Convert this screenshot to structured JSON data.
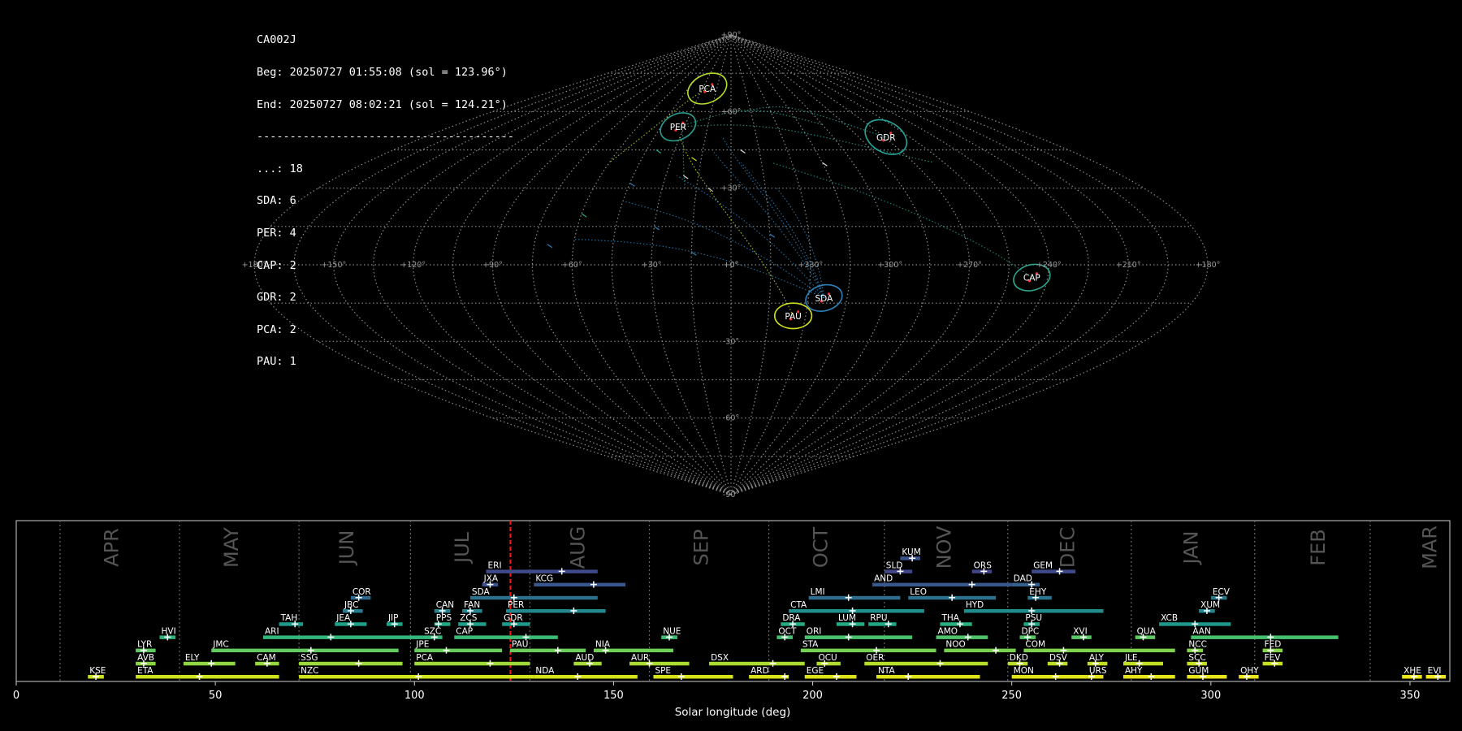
{
  "info": {
    "lines": [
      "CA002J",
      "Beg: 20250727 01:55:08 (sol = 123.96°)",
      "End: 20250727 08:02:21 (sol = 124.21°)",
      "---------------------------------------",
      "...: 18",
      "SDA: 6",
      "PER: 4",
      "CAP: 2",
      "GDR: 2",
      "PCA: 2",
      "PAU: 1"
    ]
  },
  "sky_map": {
    "projection": "sinusoidal",
    "center_lon": 0,
    "lon_labels": [
      "+180°",
      "+150°",
      "+120°",
      "+90°",
      "+60°",
      "+30°",
      "+0°",
      "+330°",
      "+300°",
      "+270°",
      "+240°",
      "+210°",
      "+180°"
    ],
    "lat_labels": [
      "+90°",
      "+60°",
      "+30°",
      "+0°",
      "-30°",
      "-60°",
      "-90°"
    ],
    "radiants": [
      {
        "code": "PCA",
        "lon": 25,
        "lat": 69,
        "r": 5.5,
        "color": "#b5de2b"
      },
      {
        "code": "PER",
        "lon": 34,
        "lat": 54,
        "r": 5,
        "color": "#2a9d8f"
      },
      {
        "code": "GDR",
        "lon": -91,
        "lat": 50,
        "r": 6,
        "color": "#26a69a"
      },
      {
        "code": "CAP",
        "lon": -114,
        "lat": -5,
        "r": 5,
        "color": "#2ea58f"
      },
      {
        "code": "SDA",
        "lon": -36,
        "lat": -13,
        "r": 5,
        "color": "#2c7fb8"
      },
      {
        "code": "PAU",
        "lon": -25,
        "lat": -20,
        "r": 5,
        "color": "#d0e11c"
      }
    ]
  },
  "chart_data": {
    "type": "timeline",
    "xlabel": "Solar longitude (deg)",
    "xlim": [
      0,
      360
    ],
    "x_ticks": [
      0,
      50,
      100,
      150,
      200,
      250,
      300,
      350
    ],
    "current_sol": 124.1,
    "months": [
      {
        "name": "APR",
        "start": 11,
        "center": 24
      },
      {
        "name": "MAY",
        "start": 41,
        "center": 54
      },
      {
        "name": "JUN",
        "start": 71,
        "center": 83
      },
      {
        "name": "JUL",
        "start": 99,
        "center": 112
      },
      {
        "name": "AUG",
        "start": 129,
        "center": 141
      },
      {
        "name": "SEP",
        "start": 159,
        "center": 172
      },
      {
        "name": "OCT",
        "start": 189,
        "center": 202
      },
      {
        "name": "NOV",
        "start": 218,
        "center": 233
      },
      {
        "name": "DEC",
        "start": 249,
        "center": 264
      },
      {
        "name": "JAN",
        "start": 280,
        "center": 295
      },
      {
        "name": "FEB",
        "start": 311,
        "center": 327
      },
      {
        "name": "MAR",
        "start": 340,
        "center": 355
      }
    ],
    "showers": [
      {
        "code": "KUM",
        "row": 9,
        "start": 222,
        "end": 227,
        "peak": 225,
        "color": "#3b528b"
      },
      {
        "code": "ERI",
        "row": 8,
        "start": 118,
        "end": 146,
        "peak": 137,
        "color": "#3e4a89"
      },
      {
        "code": "SLD",
        "row": 8,
        "start": 218,
        "end": 225,
        "peak": 222,
        "color": "#404688"
      },
      {
        "code": "ORS",
        "row": 8,
        "start": 240,
        "end": 245,
        "peak": 243,
        "color": "#414487"
      },
      {
        "code": "GEM",
        "row": 8,
        "start": 255,
        "end": 266,
        "peak": 262,
        "color": "#3e4a89"
      },
      {
        "code": "JXA",
        "row": 7,
        "start": 117,
        "end": 121,
        "peak": 119,
        "color": "#3b528b"
      },
      {
        "code": "KCG",
        "row": 7,
        "start": 130,
        "end": 153,
        "peak": 145,
        "color": "#39568c"
      },
      {
        "code": "AND",
        "row": 7,
        "start": 215,
        "end": 250,
        "peak": 240,
        "color": "#38588c"
      },
      {
        "code": "DAD",
        "row": 7,
        "start": 250,
        "end": 257,
        "peak": 255,
        "color": "#355f8d"
      },
      {
        "code": "COR",
        "row": 6,
        "start": 84,
        "end": 89,
        "peak": 86,
        "color": "#31688e"
      },
      {
        "code": "SDA",
        "row": 6,
        "start": 114,
        "end": 146,
        "peak": 125,
        "color": "#2d708e"
      },
      {
        "code": "LMI",
        "row": 6,
        "start": 199,
        "end": 222,
        "peak": 209,
        "color": "#2f6c8e"
      },
      {
        "code": "LEO",
        "row": 6,
        "start": 224,
        "end": 246,
        "peak": 235,
        "color": "#2c718e"
      },
      {
        "code": "EHY",
        "row": 6,
        "start": 254,
        "end": 260,
        "peak": 256,
        "color": "#2a768e"
      },
      {
        "code": "ECV",
        "row": 6,
        "start": 300,
        "end": 304,
        "peak": 302,
        "color": "#2a788e"
      },
      {
        "code": "JBC",
        "row": 5,
        "start": 82,
        "end": 87,
        "peak": 84,
        "color": "#287c8e"
      },
      {
        "code": "CAN",
        "row": 5,
        "start": 105,
        "end": 109,
        "peak": 107,
        "color": "#26828e"
      },
      {
        "code": "FAN",
        "row": 5,
        "start": 112,
        "end": 117,
        "peak": 114,
        "color": "#25838e"
      },
      {
        "code": "PER",
        "row": 5,
        "start": 123,
        "end": 148,
        "peak": 140,
        "color": "#23888e"
      },
      {
        "code": "CTA",
        "row": 5,
        "start": 194,
        "end": 228,
        "peak": 210,
        "color": "#21908d"
      },
      {
        "code": "HYD",
        "row": 5,
        "start": 238,
        "end": 273,
        "peak": 255,
        "color": "#228c8d"
      },
      {
        "code": "XUM",
        "row": 5,
        "start": 297,
        "end": 301,
        "peak": 299,
        "color": "#24868e"
      },
      {
        "code": "TAH",
        "row": 4,
        "start": 66,
        "end": 72,
        "peak": 70,
        "color": "#1f9a8a"
      },
      {
        "code": "JEA",
        "row": 4,
        "start": 80,
        "end": 88,
        "peak": 84,
        "color": "#1fa088"
      },
      {
        "code": "JIP",
        "row": 4,
        "start": 93,
        "end": 97,
        "peak": 95,
        "color": "#20a386"
      },
      {
        "code": "PPS",
        "row": 4,
        "start": 105,
        "end": 109,
        "peak": 106,
        "color": "#22a884"
      },
      {
        "code": "ZCS",
        "row": 4,
        "start": 111,
        "end": 118,
        "peak": 114,
        "color": "#1f9e89"
      },
      {
        "code": "GDR",
        "row": 4,
        "start": 122,
        "end": 129,
        "peak": 125,
        "color": "#1e9b8a"
      },
      {
        "code": "DRA",
        "row": 4,
        "start": 192,
        "end": 198,
        "peak": 195,
        "color": "#25ab82"
      },
      {
        "code": "LUM",
        "row": 4,
        "start": 206,
        "end": 213,
        "peak": 210,
        "color": "#23a983"
      },
      {
        "code": "RPU",
        "row": 4,
        "start": 214,
        "end": 221,
        "peak": 219,
        "color": "#22a785"
      },
      {
        "code": "THA",
        "row": 4,
        "start": 232,
        "end": 240,
        "peak": 237,
        "color": "#2ab07f"
      },
      {
        "code": "PSU",
        "row": 4,
        "start": 253,
        "end": 257,
        "peak": 255,
        "color": "#21a685"
      },
      {
        "code": "XCB",
        "row": 4,
        "start": 287,
        "end": 305,
        "peak": 296,
        "color": "#1f988b"
      },
      {
        "code": "HVI",
        "row": 3,
        "start": 36,
        "end": 40,
        "peak": 38,
        "color": "#2fb47c"
      },
      {
        "code": "ARI",
        "row": 3,
        "start": 62,
        "end": 102,
        "peak": 79,
        "color": "#33b67a"
      },
      {
        "code": "SZC",
        "row": 3,
        "start": 102,
        "end": 107,
        "peak": 105,
        "color": "#35b779"
      },
      {
        "code": "CAP",
        "row": 3,
        "start": 110,
        "end": 136,
        "peak": 128,
        "color": "#3bbb75"
      },
      {
        "code": "NUE",
        "row": 3,
        "start": 162,
        "end": 166,
        "peak": 164,
        "color": "#3fbc73"
      },
      {
        "code": "OCT",
        "row": 3,
        "start": 191,
        "end": 195,
        "peak": 193,
        "color": "#44bf70"
      },
      {
        "code": "ORI",
        "row": 3,
        "start": 198,
        "end": 225,
        "peak": 209,
        "color": "#4ac16d"
      },
      {
        "code": "AMO",
        "row": 3,
        "start": 231,
        "end": 244,
        "peak": 239,
        "color": "#50c46a"
      },
      {
        "code": "DPC",
        "row": 3,
        "start": 252,
        "end": 256,
        "peak": 254,
        "color": "#55c667"
      },
      {
        "code": "XVI",
        "row": 3,
        "start": 265,
        "end": 270,
        "peak": 268,
        "color": "#5ac864"
      },
      {
        "code": "QUA",
        "row": 3,
        "start": 281,
        "end": 286,
        "peak": 283,
        "color": "#5ec962"
      },
      {
        "code": "AAN",
        "row": 3,
        "start": 295,
        "end": 332,
        "peak": 315,
        "color": "#48c16e"
      },
      {
        "code": "LYR",
        "row": 2,
        "start": 30,
        "end": 35,
        "peak": 32,
        "color": "#5ec962"
      },
      {
        "code": "JMC",
        "row": 2,
        "start": 49,
        "end": 96,
        "peak": 74,
        "color": "#63cb5f"
      },
      {
        "code": "JPE",
        "row": 2,
        "start": 100,
        "end": 122,
        "peak": 108,
        "color": "#67cc5c"
      },
      {
        "code": "PAU",
        "row": 2,
        "start": 124,
        "end": 143,
        "peak": 136,
        "color": "#6ccd5a"
      },
      {
        "code": "NIA",
        "row": 2,
        "start": 145,
        "end": 165,
        "peak": 148,
        "color": "#70cf57"
      },
      {
        "code": "STA",
        "row": 2,
        "start": 197,
        "end": 231,
        "peak": 216,
        "color": "#75d054"
      },
      {
        "code": "NOO",
        "row": 2,
        "start": 233,
        "end": 251,
        "peak": 246,
        "color": "#7ad151"
      },
      {
        "code": "COM",
        "row": 2,
        "start": 253,
        "end": 291,
        "peak": 263,
        "color": "#7fd34e"
      },
      {
        "code": "NCC",
        "row": 2,
        "start": 294,
        "end": 298,
        "peak": 296,
        "color": "#84d44b"
      },
      {
        "code": "FED",
        "row": 2,
        "start": 313,
        "end": 318,
        "peak": 315,
        "color": "#86d549"
      },
      {
        "code": "AVB",
        "row": 1,
        "start": 30,
        "end": 35,
        "peak": 32,
        "color": "#8bd646"
      },
      {
        "code": "ELY",
        "row": 1,
        "start": 42,
        "end": 55,
        "peak": 49,
        "color": "#90d743"
      },
      {
        "code": "CAM",
        "row": 1,
        "start": 60,
        "end": 66,
        "peak": 63,
        "color": "#95d840"
      },
      {
        "code": "SSG",
        "row": 1,
        "start": 71,
        "end": 97,
        "peak": 86,
        "color": "#9bd93c"
      },
      {
        "code": "PCA",
        "row": 1,
        "start": 100,
        "end": 129,
        "peak": 119,
        "color": "#a0da39"
      },
      {
        "code": "AUD",
        "row": 1,
        "start": 140,
        "end": 147,
        "peak": 144,
        "color": "#a5db36"
      },
      {
        "code": "AUR",
        "row": 1,
        "start": 154,
        "end": 169,
        "peak": 159,
        "color": "#aadc32"
      },
      {
        "code": "DSX",
        "row": 1,
        "start": 174,
        "end": 198,
        "peak": 190,
        "color": "#addc30"
      },
      {
        "code": "OCU",
        "row": 1,
        "start": 201,
        "end": 207,
        "peak": 203,
        "color": "#b0dd2f"
      },
      {
        "code": "OER",
        "row": 1,
        "start": 213,
        "end": 244,
        "peak": 232,
        "color": "#b5de2b"
      },
      {
        "code": "DKD",
        "row": 1,
        "start": 249,
        "end": 254,
        "peak": 252,
        "color": "#b8de29"
      },
      {
        "code": "DSV",
        "row": 1,
        "start": 259,
        "end": 264,
        "peak": 262,
        "color": "#bade28"
      },
      {
        "code": "ALY",
        "row": 1,
        "start": 269,
        "end": 274,
        "peak": 271,
        "color": "#bfdf25"
      },
      {
        "code": "JLE",
        "row": 1,
        "start": 278,
        "end": 288,
        "peak": 282,
        "color": "#c2df23"
      },
      {
        "code": "SCC",
        "row": 1,
        "start": 294,
        "end": 299,
        "peak": 297,
        "color": "#c5e021"
      },
      {
        "code": "FEV",
        "row": 1,
        "start": 313,
        "end": 318,
        "peak": 316,
        "color": "#c8e020"
      },
      {
        "code": "KSE",
        "row": 0,
        "start": 18,
        "end": 22,
        "peak": 20,
        "color": "#cae11f"
      },
      {
        "code": "ETA",
        "row": 0,
        "start": 30,
        "end": 66,
        "peak": 46,
        "color": "#cde11d"
      },
      {
        "code": "NZC",
        "row": 0,
        "start": 71,
        "end": 130,
        "peak": 101,
        "color": "#d2e21b"
      },
      {
        "code": "NDA",
        "row": 0,
        "start": 130,
        "end": 156,
        "peak": 141,
        "color": "#d5e21a"
      },
      {
        "code": "SPE",
        "row": 0,
        "start": 160,
        "end": 180,
        "peak": 167,
        "color": "#d8e219"
      },
      {
        "code": "ARD",
        "row": 0,
        "start": 184,
        "end": 194,
        "peak": 193,
        "color": "#dae319"
      },
      {
        "code": "EGE",
        "row": 0,
        "start": 198,
        "end": 211,
        "peak": 206,
        "color": "#dde318"
      },
      {
        "code": "NTA",
        "row": 0,
        "start": 216,
        "end": 242,
        "peak": 224,
        "color": "#e0e318"
      },
      {
        "code": "MON",
        "row": 0,
        "start": 250,
        "end": 269,
        "peak": 261,
        "color": "#e2e418"
      },
      {
        "code": "URS",
        "row": 0,
        "start": 269,
        "end": 273,
        "peak": 270,
        "color": "#e5e419"
      },
      {
        "code": "AHY",
        "row": 0,
        "start": 278,
        "end": 291,
        "peak": 285,
        "color": "#e7e419"
      },
      {
        "code": "GUM",
        "row": 0,
        "start": 294,
        "end": 304,
        "peak": 298,
        "color": "#eae51a"
      },
      {
        "code": "OHY",
        "row": 0,
        "start": 307,
        "end": 312,
        "peak": 309,
        "color": "#ece51b"
      },
      {
        "code": "XHE",
        "row": 0,
        "start": 348,
        "end": 353,
        "peak": 351,
        "color": "#efe51c"
      },
      {
        "code": "EVI",
        "row": 0,
        "start": 354,
        "end": 359,
        "peak": 357,
        "color": "#f1e51d"
      }
    ]
  }
}
